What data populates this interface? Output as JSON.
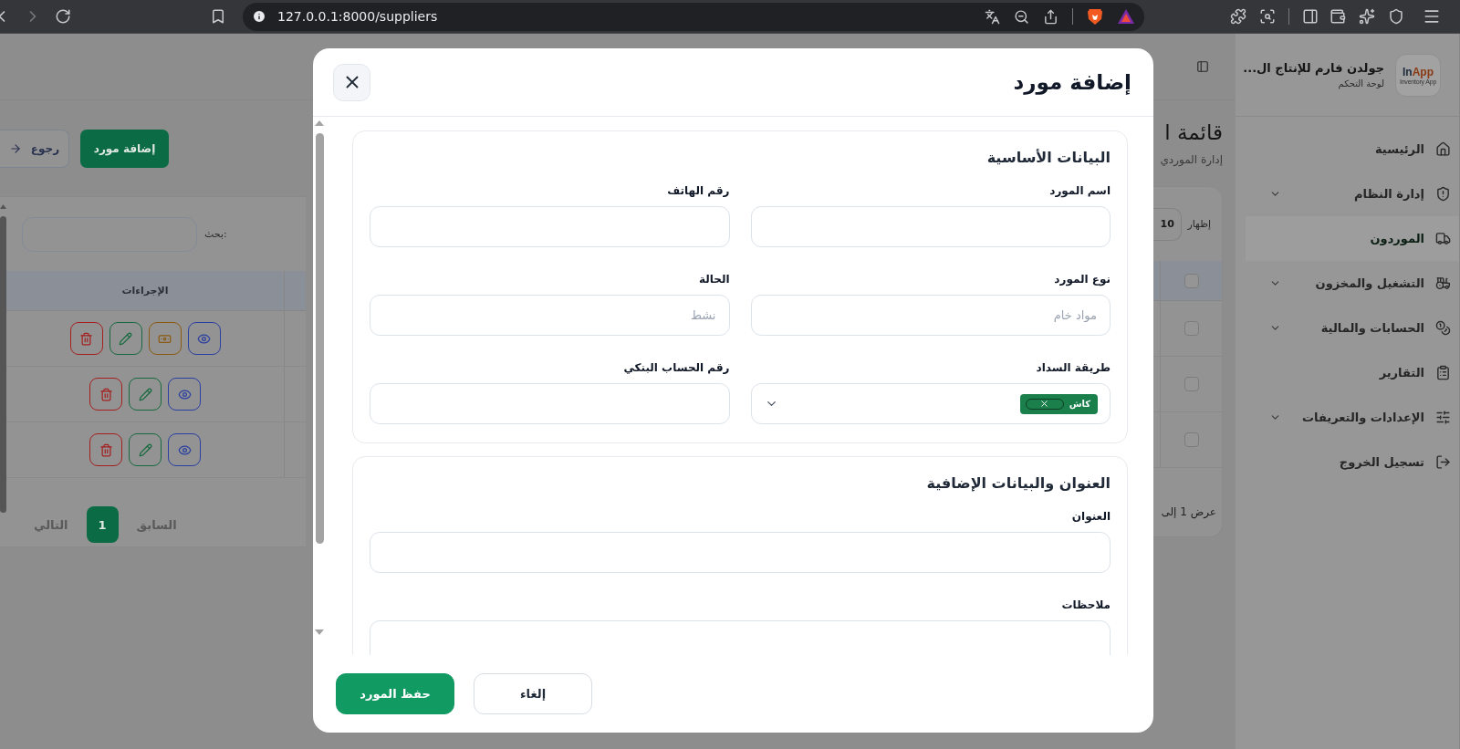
{
  "browser": {
    "url": "127.0.0.1:8000/suppliers"
  },
  "sidebar": {
    "logo": {
      "brand_first": "In",
      "brand_second": "App",
      "tagline": "Inventory App"
    },
    "app_name": "جولدن فارم للإنتاج ال...",
    "subtitle": "لوحة التحكم",
    "items": [
      {
        "label": "الرئيسية",
        "expandable": false,
        "selected": false
      },
      {
        "label": "إدارة النظام",
        "expandable": true,
        "selected": false
      },
      {
        "label": "الموردون",
        "expandable": false,
        "selected": true
      },
      {
        "label": "التشغيل والمخزون",
        "expandable": true,
        "selected": false
      },
      {
        "label": "الحسابات والمالية",
        "expandable": true,
        "selected": false
      },
      {
        "label": "التقارير",
        "expandable": false,
        "selected": false
      },
      {
        "label": "الإعدادات والتعريفات",
        "expandable": true,
        "selected": false
      },
      {
        "label": "تسجيل الخروج",
        "expandable": false,
        "selected": false
      }
    ]
  },
  "page": {
    "title": "قائمة ا",
    "subtitle": "إدارة الموردي",
    "add_button": "إضافة مورد",
    "back_button": "رجوع"
  },
  "table": {
    "show_label": "إظهار",
    "page_size": "10",
    "search_label": "بحث:",
    "actions_header": "الإجراءات",
    "header_checked": false,
    "rows": [
      {
        "checked": false,
        "actions": [
          {
            "kind": "view"
          },
          {
            "kind": "cash"
          },
          {
            "kind": "edit"
          },
          {
            "kind": "delete"
          }
        ]
      },
      {
        "checked": false,
        "actions": [
          {
            "kind": "view"
          },
          {
            "kind": "edit"
          },
          {
            "kind": "delete"
          }
        ]
      },
      {
        "checked": false,
        "actions": [
          {
            "kind": "view"
          },
          {
            "kind": "edit"
          },
          {
            "kind": "delete"
          }
        ]
      }
    ],
    "info": "عرض 1 إلى"
  },
  "pagination": {
    "previous": "السابق",
    "pages": [
      {
        "label": "1",
        "selected": true
      }
    ],
    "next": "التالي"
  },
  "modal": {
    "title": "إضافة مورد",
    "sections": [
      {
        "title": "البيانات الأساسية",
        "fields": [
          {
            "label": "اسم المورد",
            "kind": "text"
          },
          {
            "label": "رقم الهاتف",
            "kind": "text"
          },
          {
            "label": "نوع المورد",
            "kind": "text",
            "placeholder": "مواد خام"
          },
          {
            "label": "الحالة",
            "kind": "text",
            "placeholder": "نشط"
          },
          {
            "label": "طريقة السداد",
            "kind": "multiselect",
            "tags": [
              "كاش"
            ]
          },
          {
            "label": "رقم الحساب البنكي",
            "kind": "text"
          }
        ]
      },
      {
        "title": "العنوان والبيانات الإضافية",
        "fields": [
          {
            "label": "العنوان",
            "kind": "wide"
          },
          {
            "label": "ملاحظات",
            "kind": "textarea"
          }
        ]
      }
    ],
    "buttons": [
      {
        "label": "إلغاء",
        "kind": "secondary"
      },
      {
        "label": "حفظ المورد",
        "kind": "primary"
      }
    ]
  }
}
